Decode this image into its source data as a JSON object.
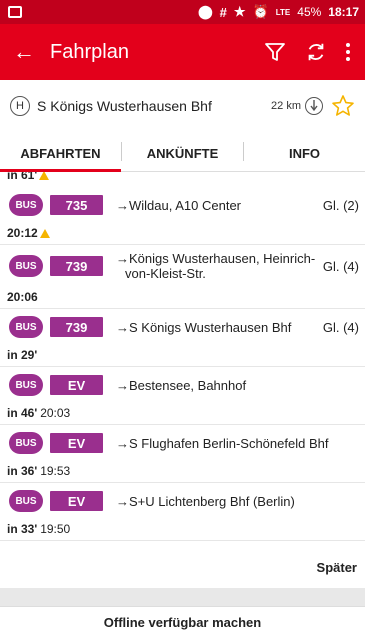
{
  "status": {
    "battery": "45%",
    "time": "18:17",
    "hash": "#",
    "signal_label": "LTE"
  },
  "appbar": {
    "title": "Fahrplan"
  },
  "station": {
    "h_label": "H",
    "name": "S Königs Wusterhausen Bhf",
    "distance": "22 km"
  },
  "tabs": [
    "ABFAHRTEN",
    "ANKÜNFTE",
    "INFO"
  ],
  "badge_label": "BUS",
  "top_time": "in 61'",
  "departures": [
    {
      "line": "735",
      "destination": "→Wildau, A10 Center",
      "platform": "Gl. (2)",
      "time": "20:12",
      "sub": "",
      "warning": true
    },
    {
      "line": "739",
      "destination": "→Königs Wusterhausen, Heinrich-von-Kleist-Str.",
      "platform": "Gl. (4)",
      "time": "20:06",
      "sub": "",
      "warning": false
    },
    {
      "line": "739",
      "destination": "→S Königs Wusterhausen Bhf",
      "platform": "Gl. (4)",
      "time": "in 29'",
      "sub": "",
      "warning": false
    },
    {
      "line": "EV",
      "destination": "→Bestensee, Bahnhof",
      "platform": "",
      "time": "in 46'",
      "sub": "20:03",
      "warning": false
    },
    {
      "line": "EV",
      "destination": "→S Flughafen Berlin-Schönefeld Bhf",
      "platform": "",
      "time": "in 36'",
      "sub": "19:53",
      "warning": false
    },
    {
      "line": "EV",
      "destination": "→S+U Lichtenberg Bhf (Berlin)",
      "platform": "",
      "time": "in 33'",
      "sub": "19:50",
      "warning": false
    }
  ],
  "later_label": "Später",
  "offline_label": "Offline verfügbar machen",
  "colors": {
    "statusbar": "#c0001c",
    "appbar": "#e3001b",
    "line_badge": "#9a2f8e",
    "warning": "#f5b400"
  },
  "icons": [
    "back-arrow-icon",
    "filter-icon",
    "refresh-icon",
    "overflow-menu-icon",
    "compass-icon",
    "star-icon",
    "warning-icon"
  ]
}
